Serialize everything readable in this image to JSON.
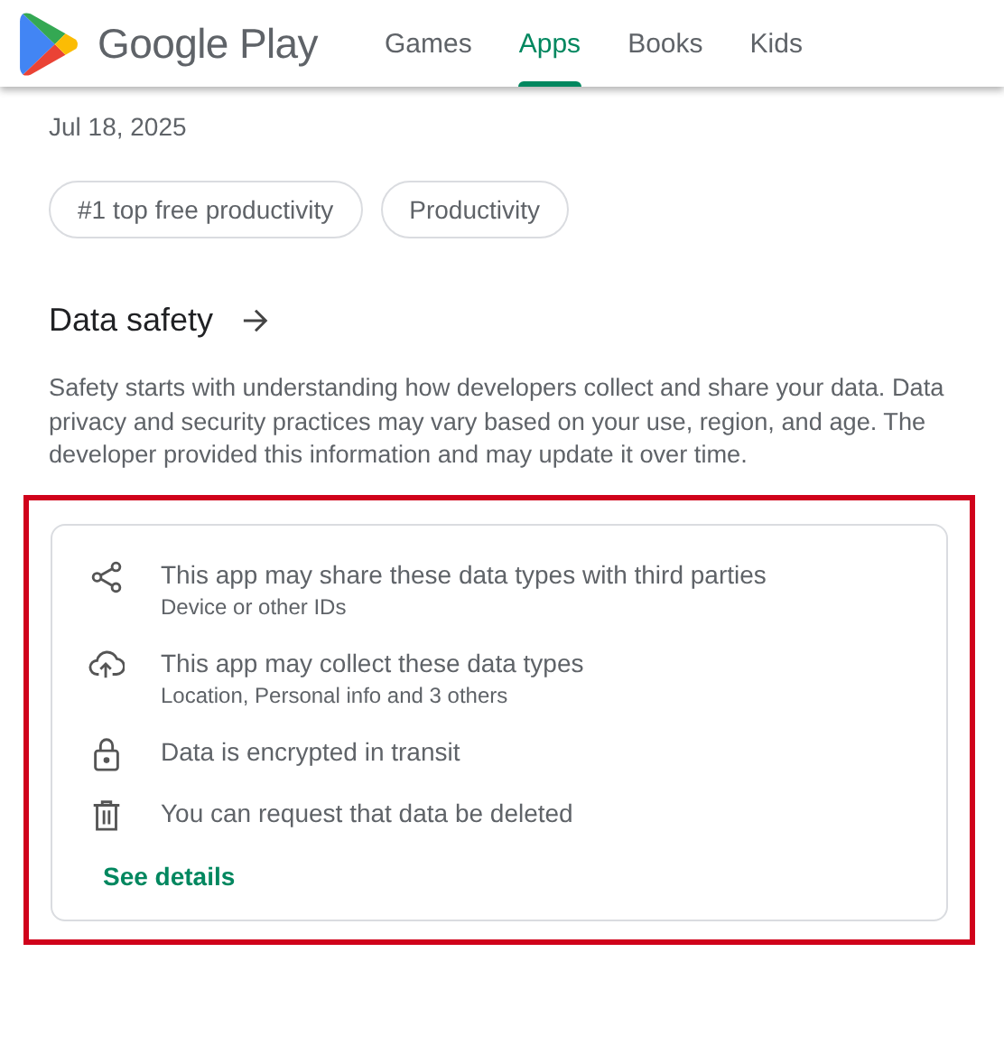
{
  "header": {
    "brand": "Google Play",
    "tabs": [
      {
        "label": "Games",
        "selected": false
      },
      {
        "label": "Apps",
        "selected": true
      },
      {
        "label": "Books",
        "selected": false
      },
      {
        "label": "Kids",
        "selected": false
      }
    ]
  },
  "updated": {
    "date": "Jul 18, 2025"
  },
  "chips": [
    "#1 top free productivity",
    "Productivity"
  ],
  "data_safety": {
    "title": "Data safety",
    "description": "Safety starts with understanding how developers collect and share your data. Data privacy and security practices may vary based on your use, region, and age. The developer provided this information and may update it over time.",
    "highlighted": true,
    "items": [
      {
        "kind": "share",
        "text": "This app may share these data types with third parties",
        "detail": "Device or other IDs"
      },
      {
        "kind": "collect",
        "text": "This app may collect these data types",
        "detail": "Location, Personal info and 3 others"
      },
      {
        "kind": "lock",
        "text": "Data is encrypted in transit"
      },
      {
        "kind": "delete",
        "text": "You can request that data be deleted"
      }
    ],
    "link": "See details"
  }
}
